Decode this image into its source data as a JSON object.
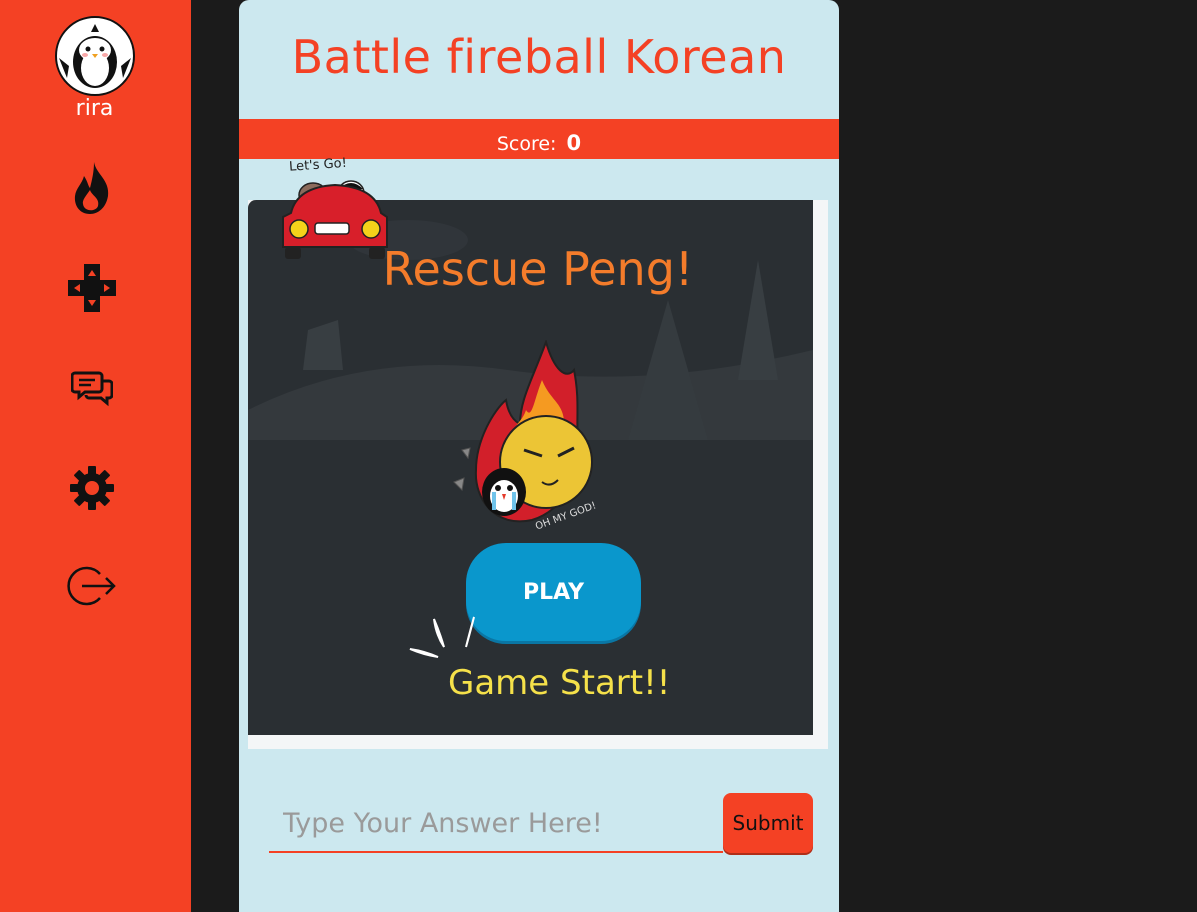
{
  "sidebar": {
    "username": "rira",
    "icons": [
      "penguin-avatar",
      "fire-icon",
      "gamepad-icon",
      "chat-icon",
      "gear-icon",
      "logout-icon"
    ],
    "accent": "#f44124"
  },
  "header": {
    "title": "Battle fireball Korean",
    "score_label": "Score:",
    "score_value": "0"
  },
  "game": {
    "title": "Rescue Peng!",
    "play_label": "PLAY",
    "start_text": "Game Start!!",
    "car_caption": "Let's Go!",
    "fireball_caption": "OH MY GOD!"
  },
  "answer": {
    "placeholder": "Type Your Answer Here!",
    "submit_label": "Submit"
  }
}
